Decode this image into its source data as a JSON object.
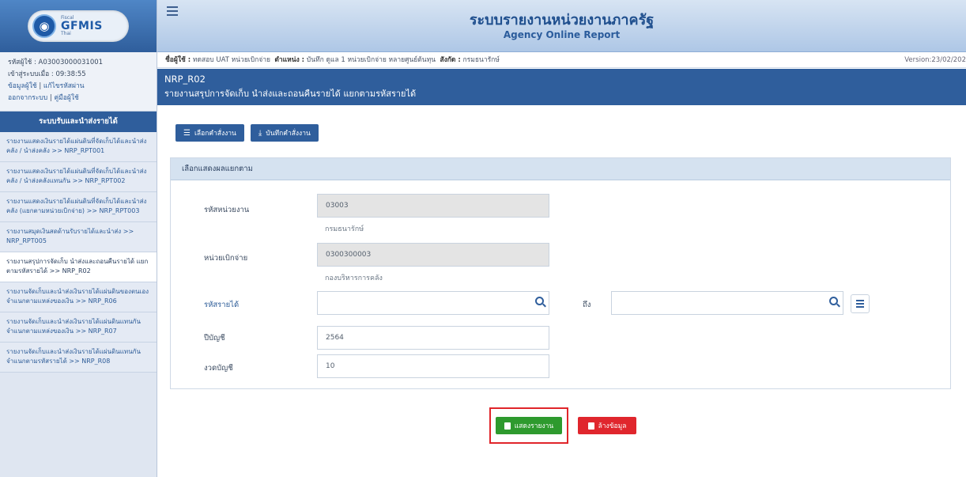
{
  "logo": {
    "small": "Fiscal",
    "main": "GFMIS",
    "sub": "Thai"
  },
  "user": {
    "id_line": "รหัสผู้ใช้ : A03003000031001",
    "login_line": "เข้าสู่ระบบเมื่อ : 09:38:55",
    "profile_link": "ข้อมูลผู้ใช้",
    "sep": "|",
    "password_link": "แก้ไขรหัสผ่าน",
    "logout_link": "ออกจากระบบ",
    "manual_link": "คู่มือผู้ใช้"
  },
  "sidebar": {
    "heading": "ระบบรับและนำส่งรายได้",
    "items": [
      {
        "label": "รายงานแสดงเงินรายได้แผ่นดินที่จัดเก็บได้และนำส่งคลัง / นำส่งคลัง >> NRP_RPT001"
      },
      {
        "label": "รายงานแสดงเงินรายได้แผ่นดินที่จัดเก็บได้และนำส่งคลัง / นำส่งคลังแทนกัน >> NRP_RPT002"
      },
      {
        "label": "รายงานแสดงเงินรายได้แผ่นดินที่จัดเก็บได้และนำส่งคลัง (แยกตามหน่วยเบิกจ่าย) >> NRP_RPT003"
      },
      {
        "label": "รายงานสมุดเงินสดด้านรับรายได้และนำส่ง >> NRP_RPT005"
      },
      {
        "label": "รายงานสรุปการจัดเก็บ นำส่งและถอนคืนรายได้ แยกตามรหัสรายได้ >> NRP_R02"
      },
      {
        "label": "รายงานจัดเก็บและนำส่งเงินรายได้แผ่นดินของตนเอง จำแนกตามแหล่งของเงิน >> NRP_R06"
      },
      {
        "label": "รายงานจัดเก็บและนำส่งเงินรายได้แผ่นดินแทนกัน จำแนกตามแหล่งของเงิน >> NRP_R07"
      },
      {
        "label": "รายงานจัดเก็บและนำส่งเงินรายได้แผ่นดินแทนกัน จำแนกตามรหัสรายได้ >> NRP_R08"
      }
    ]
  },
  "header": {
    "title": "ระบบรายงานหน่วยงานภาครัฐ",
    "subtitle": "Agency Online Report"
  },
  "infobar": {
    "name_label": "ชื่อผู้ใช้ :",
    "name_value": "ทดสอบ UAT หน่วยเบิกจ่าย",
    "position_label": "ตำแหน่ง :",
    "position_value": "บันทึก ดูแล 1 หน่วยเบิกจ่าย หลายศูนย์ต้นทุน",
    "org_label": "สังกัด :",
    "org_value": "กรมธนารักษ์",
    "version": "Version:23/02/202"
  },
  "page": {
    "code": "NRP_R02",
    "name": "รายงานสรุปการจัดเก็บ นำส่งและถอนคืนรายได้ แยกตามรหัสรายได้"
  },
  "toolbar": {
    "select_label": "เลือกคำสั่งงาน",
    "save_label": "บันทึกคำสั่งงาน"
  },
  "form": {
    "panel_title": "เลือกแสดงผลแยกตาม",
    "agency_label": "รหัสหน่วยงาน",
    "agency_value": "03003",
    "agency_name": "กรมธนารักษ์",
    "unit_label": "หน่วยเบิกจ่าย",
    "unit_value": "0300300003",
    "unit_name": "กองบริหารการคลัง",
    "revenue_label": "รหัสรายได้",
    "revenue_from_value": "",
    "to_label": "ถึง",
    "revenue_to_value": "",
    "year_label": "ปีบัญชี",
    "year_value": "2564",
    "period_label": "งวดบัญชี",
    "period_value": "10"
  },
  "actions": {
    "show_label": "แสดงรายงาน",
    "clear_label": "ล้างข้อมูล"
  },
  "colors": {
    "primary": "#2f5e9c",
    "green": "#2e9a2e",
    "red": "#e0262d",
    "highlight": "#e0252a"
  }
}
